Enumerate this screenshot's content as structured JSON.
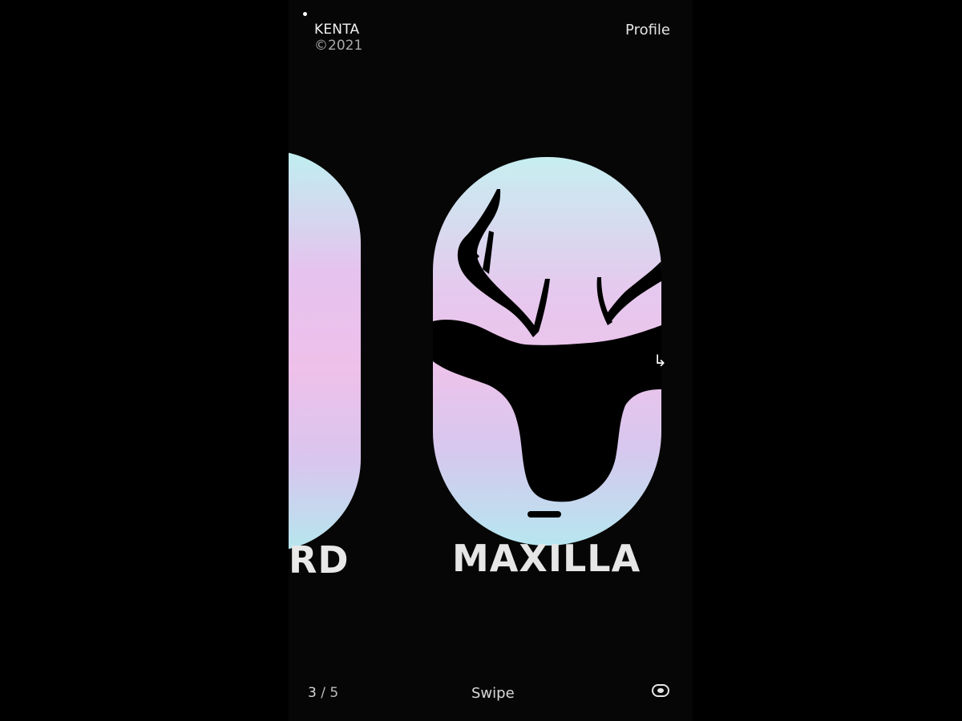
{
  "header": {
    "brand_name": "KENTA",
    "brand_year": "©2021",
    "profile_label": "Profile"
  },
  "slides": {
    "previous_title_visible": "RD",
    "current_title": "MAXILLA",
    "current_image": "deer-head-silhouette"
  },
  "footer": {
    "current_index": "3",
    "separator": " / ",
    "total": "5",
    "swipe_label": "Swipe",
    "toggle_icon": "toggle-icon"
  },
  "colors": {
    "background": "#060606",
    "card_gradient": [
      "#c7eef0",
      "#e6c8ee",
      "#ecc3ea",
      "#b7e6ef"
    ],
    "text": "#e6e6e6"
  }
}
